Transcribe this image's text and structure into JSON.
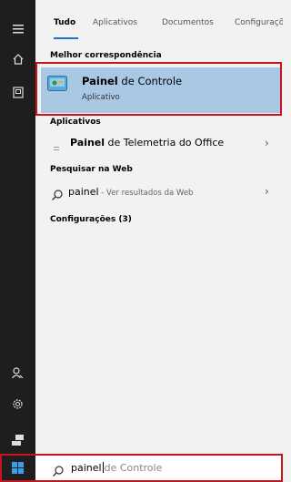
{
  "tabs": [
    "Tudo",
    "Aplicativos",
    "Documentos",
    "Configuraçõ"
  ],
  "best_match": {
    "section": "Melhor correspondência",
    "title_bold": "Painel",
    "title_rest": " de Controle",
    "subtitle": "Aplicativo"
  },
  "apps": {
    "section": "Aplicativos",
    "item_bold": "Painel",
    "item_rest": " de Telemetria do Office"
  },
  "web": {
    "section": "Pesquisar na Web",
    "query": "painel",
    "hint": " - Ver resultados da Web"
  },
  "settings": {
    "section": "Configurações (3)"
  },
  "search": {
    "typed": "painel",
    "suggestion": "de Controle"
  },
  "colors": {
    "accent": "#1b74d4",
    "highlight_border": "#c8141e",
    "selected_bg": "#a9c8e4",
    "rail": "#1e1e1e"
  },
  "icons": [
    "hamburger-icon",
    "home-icon",
    "collection-icon",
    "person-icon",
    "gear-icon",
    "device-icon",
    "windows-logo-icon",
    "search-icon",
    "control-panel-icon",
    "telemetry-icon",
    "chevron-right-icon"
  ]
}
